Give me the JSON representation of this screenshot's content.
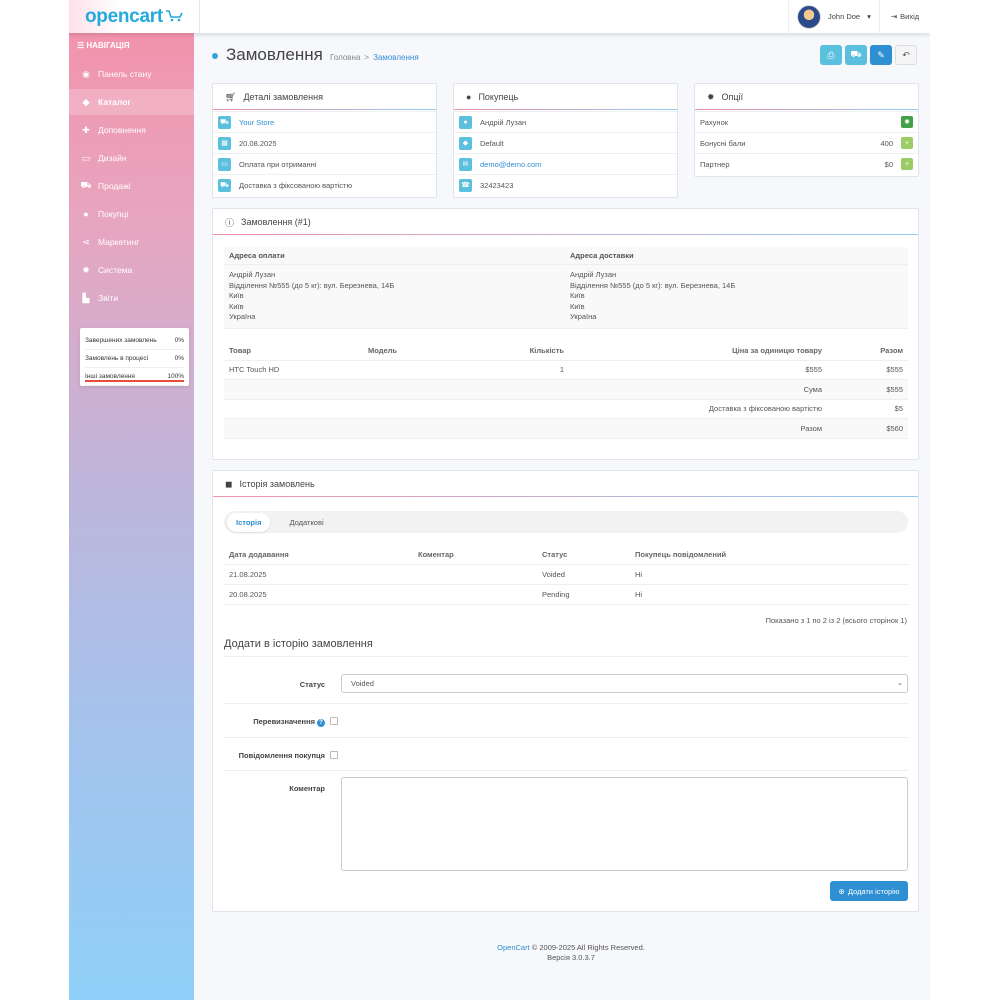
{
  "header": {
    "logo": "opencart",
    "user_name": "John Doe",
    "logout_label": "Вихід"
  },
  "sidebar": {
    "nav_heading": "НАВІГАЦІЯ",
    "items": [
      {
        "label": "Панель стану",
        "icon": "dashboard-icon"
      },
      {
        "label": "Каталог",
        "icon": "tag-icon"
      },
      {
        "label": "Доповнення",
        "icon": "puzzle-icon"
      },
      {
        "label": "Дизайн",
        "icon": "monitor-icon"
      },
      {
        "label": "Продажі",
        "icon": "cart-icon"
      },
      {
        "label": "Покупці",
        "icon": "user-icon"
      },
      {
        "label": "Маркетинг",
        "icon": "share-icon"
      },
      {
        "label": "Система",
        "icon": "gear-icon"
      },
      {
        "label": "Звіти",
        "icon": "chart-icon"
      }
    ],
    "stats": [
      {
        "label": "Завершених замовлень",
        "value": "0%"
      },
      {
        "label": "Замовлень в процесі",
        "value": "0%"
      },
      {
        "label": "Інші замовлення",
        "value": "100%"
      }
    ]
  },
  "page": {
    "title": "Замовлення",
    "breadcrumb": [
      "Головна",
      "Замовлення"
    ]
  },
  "order_details": {
    "title": "Деталі замовлення",
    "store": "Your Store",
    "date": "20.08.2025",
    "payment": "Оплата при отриманні",
    "shipping": "Доставка з фіксованою вартістю"
  },
  "customer": {
    "title": "Покупець",
    "name": "Андрій Лузан",
    "group": "Default",
    "email": "demo@demo.com",
    "phone": "32423423"
  },
  "options": {
    "title": "Опції",
    "rows": [
      {
        "label": "Рахунок",
        "value": ""
      },
      {
        "label": "Бонусні бали",
        "value": "400"
      },
      {
        "label": "Партнер",
        "value": "$0"
      }
    ]
  },
  "order": {
    "title": "Замовлення (#1)",
    "payment_address_label": "Адреса оплати",
    "shipping_address_label": "Адреса доставки",
    "payment_address": [
      "Андрій Лузан",
      "Відділення №555 (до 5 кг): вул. Березнева, 14Б",
      "Київ",
      "Київ",
      "Україна"
    ],
    "shipping_address": [
      "Андрій Лузан",
      "Відділення №555 (до 5 кг): вул. Березнева, 14Б",
      "Київ",
      "Київ",
      "Україна"
    ],
    "columns": {
      "product": "Товар",
      "model": "Модель",
      "qty": "Кількість",
      "price": "Ціна за одиницю товару",
      "total": "Разом"
    },
    "product": {
      "name": "HTC Touch HD",
      "model": "",
      "qty": "1",
      "price": "$555",
      "total": "$555"
    },
    "totals": [
      {
        "label": "Сума",
        "value": "$555"
      },
      {
        "label": "Доставка з фіксованою вартістю",
        "value": "$5"
      },
      {
        "label": "Разом",
        "value": "$560"
      }
    ]
  },
  "history": {
    "title": "Історія замовлень",
    "tabs": [
      "Історія",
      "Додаткові"
    ],
    "columns": {
      "date": "Дата додавання",
      "comment": "Коментар",
      "status": "Статус",
      "notified": "Покупець повідомлений"
    },
    "rows": [
      {
        "date": "21.08.2025",
        "comment": "",
        "status": "Voided",
        "notified": "Ні"
      },
      {
        "date": "20.08.2025",
        "comment": "",
        "status": "Pending",
        "notified": "Ні"
      }
    ],
    "pagination": "Показано з 1 по 2 із 2 (всього сторінок 1)",
    "add_title": "Додати в історію замовлення",
    "status_label": "Статус",
    "status_value": "Voided",
    "override_label": "Перевизначення",
    "notify_label": "Повідомлення покупця",
    "comment_label": "Коментар",
    "add_button": "Додати історію"
  },
  "footer": {
    "brand": "OpenCart",
    "copyright": "© 2009-2025 All Rights Reserved.",
    "version": "Версія 3.0.3.7"
  }
}
